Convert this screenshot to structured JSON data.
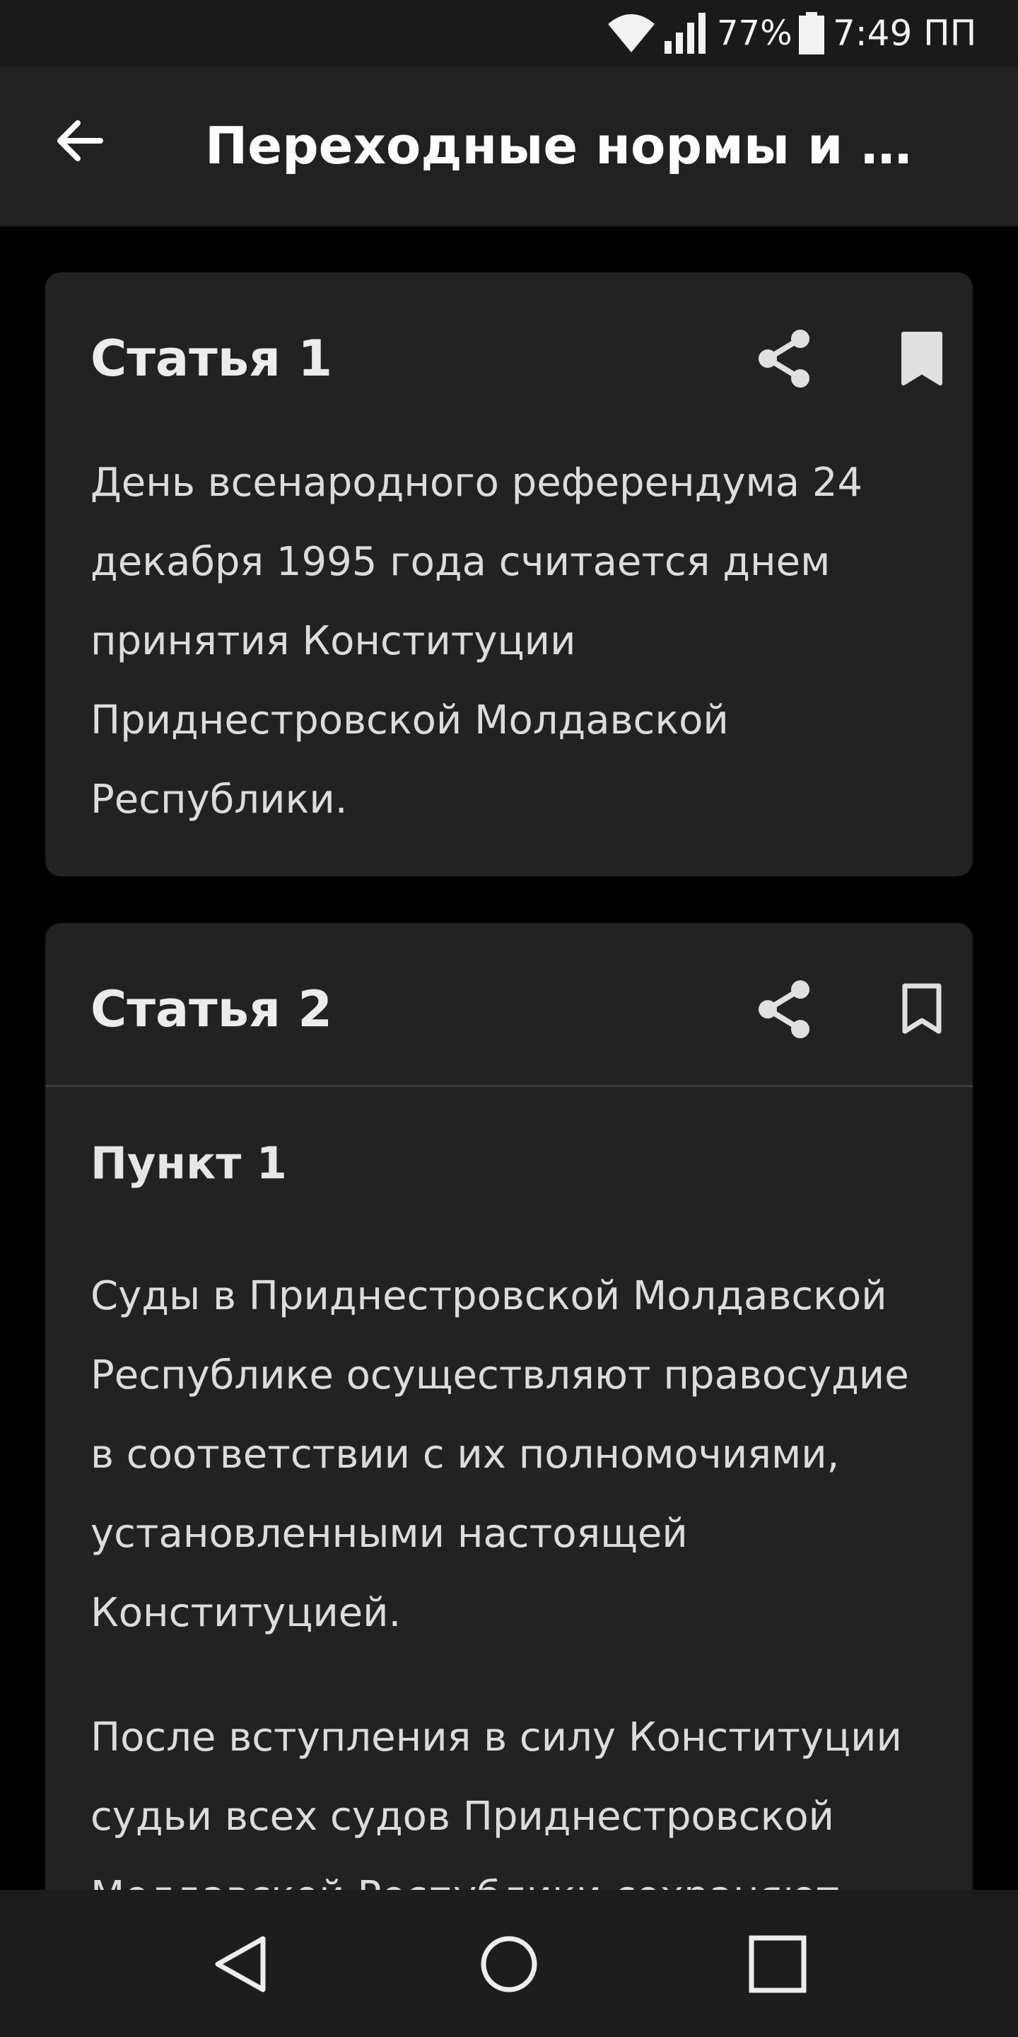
{
  "status_bar": {
    "battery_percent": "77%",
    "time": "7:49 ПП",
    "icons": [
      "wifi-icon",
      "signal-icon",
      "battery-icon"
    ]
  },
  "app_bar": {
    "title": "Переходные нормы и …",
    "back_icon": "arrow-left-icon"
  },
  "cards": [
    {
      "title": "Статья 1",
      "bookmarked": true,
      "text": "День всенародного референдума 24 декабря 1995 года считается днем принятия Конституции Приднестровской Молдавской Республики."
    },
    {
      "title": "Статья 2",
      "bookmarked": false,
      "point_title": "Пункт 1",
      "paragraphs": [
        "Суды в Приднестровской Молдавской Республике осуществляют правосудие в соответствии с их полномочиями, установленными настоящей Конституцией.",
        "После вступления в силу Конституции судьи всех судов Приднестровской Молдавской Республики сохраняют"
      ]
    }
  ],
  "nav_bar": {
    "icons": [
      "nav-back-icon",
      "nav-home-icon",
      "nav-recents-icon"
    ]
  },
  "colors": {
    "background": "#000000",
    "surface": "#222222",
    "app_bar": "#212121",
    "text_primary": "#ececec",
    "icon": "#e0e0e0"
  }
}
